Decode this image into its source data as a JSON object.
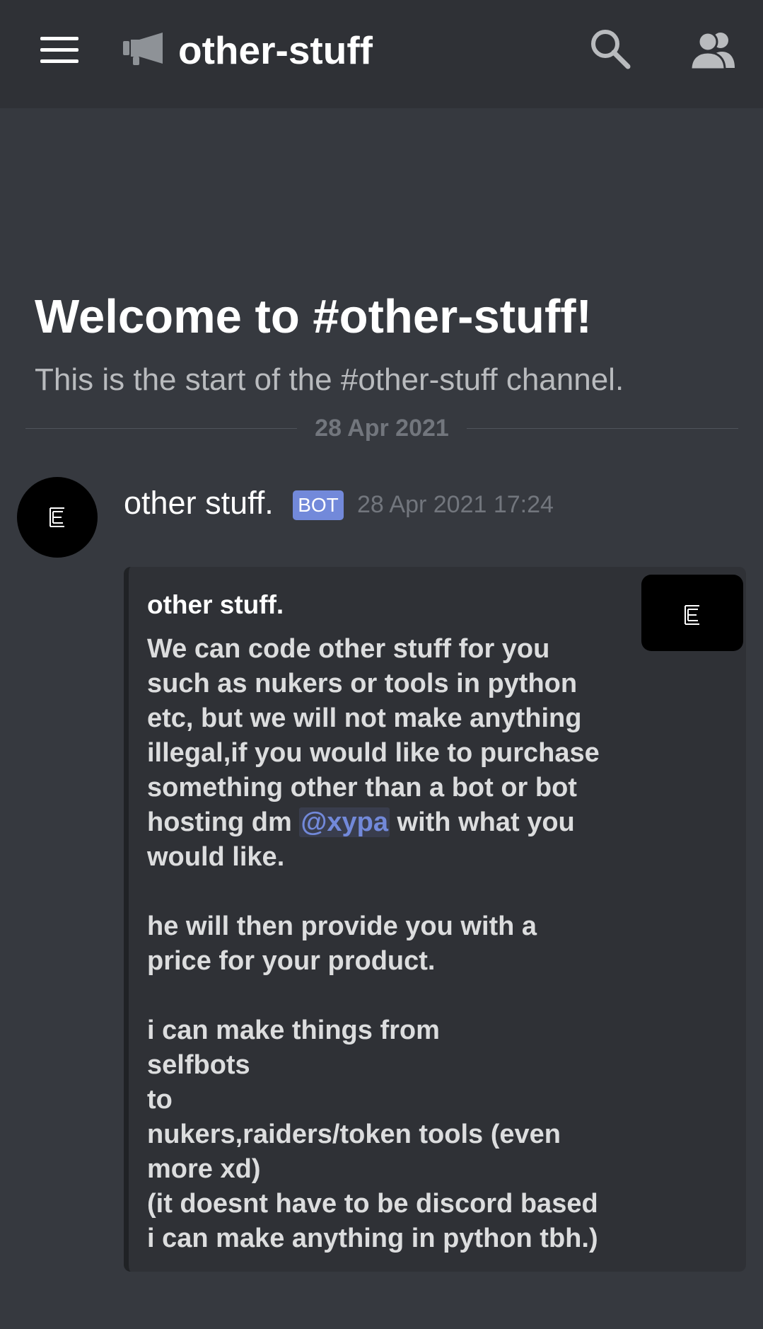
{
  "header": {
    "channel_name": "other-stuff",
    "menu_icon": "hamburger-menu-icon",
    "channel_icon": "announcement-megaphone-icon",
    "search_icon": "search-icon",
    "members_icon": "members-icon"
  },
  "welcome": {
    "title": "Welcome to #other-stuff!",
    "subtitle": "This is the start of the #other-stuff channel."
  },
  "divider": {
    "date": "28 Apr 2021"
  },
  "message": {
    "author": "other stuff.",
    "badge": "BOT",
    "timestamp": "28 Apr 2021 17:24",
    "avatar_icon": "bot-avatar-logo",
    "embed": {
      "title": "other stuff.",
      "thumbnail_icon": "embed-thumbnail-logo",
      "lines": {
        "l1": "We can code other stuff for you",
        "l2": "such as nukers or tools in python",
        "l3": "etc, but we will not make anything",
        "l4": "illegal,if you would like to purchase",
        "l5": "something other than a bot or bot",
        "l6_before": "hosting dm ",
        "l6_mention": "@xypa",
        "l6_after": " with what you",
        "l7": "would like.",
        "l8": "he will then provide you with a",
        "l9": "price for your product.",
        "l10": "i can make things from",
        "l11": "selfbots",
        "l12": "to",
        "l13": "nukers,raiders/token tools (even",
        "l14": "more xd)",
        "l15": "(it doesnt have to be discord based",
        "l16": "i can make anything in python tbh.)"
      }
    }
  },
  "colors": {
    "background": "#36393f",
    "header": "#2f3136",
    "embed": "#2f3136",
    "bot_badge": "#7289da",
    "mention": "#7289da",
    "muted_text": "#72767d"
  }
}
